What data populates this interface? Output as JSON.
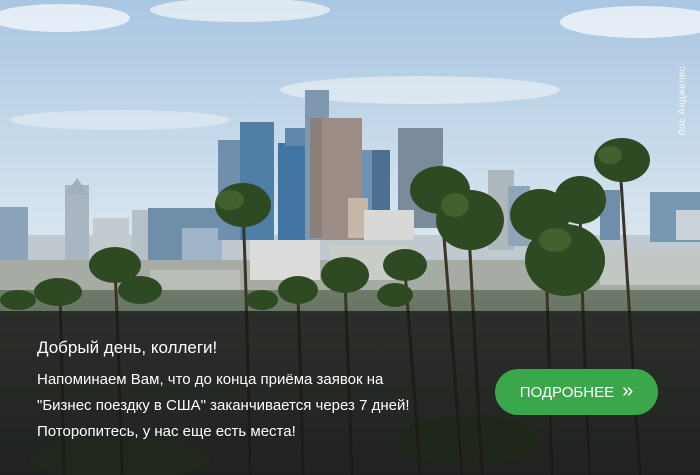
{
  "banner": {
    "photo_caption": "Лос Анджелес",
    "greeting": "Добрый день, коллеги!",
    "message": "Напоминаем Вам, что до конца приёма заявок на \"Бизнес поездку в США\" заканчивается через 7 дней! Поторопитесь, у нас еще есть места!",
    "cta_label": "ПОДРОБНЕЕ",
    "cta_icon": "double-chevron-right-icon",
    "cta_glyph": "»"
  },
  "colors": {
    "cta_background": "#3aa74a",
    "overlay": "#141414",
    "text": "#ffffff"
  }
}
